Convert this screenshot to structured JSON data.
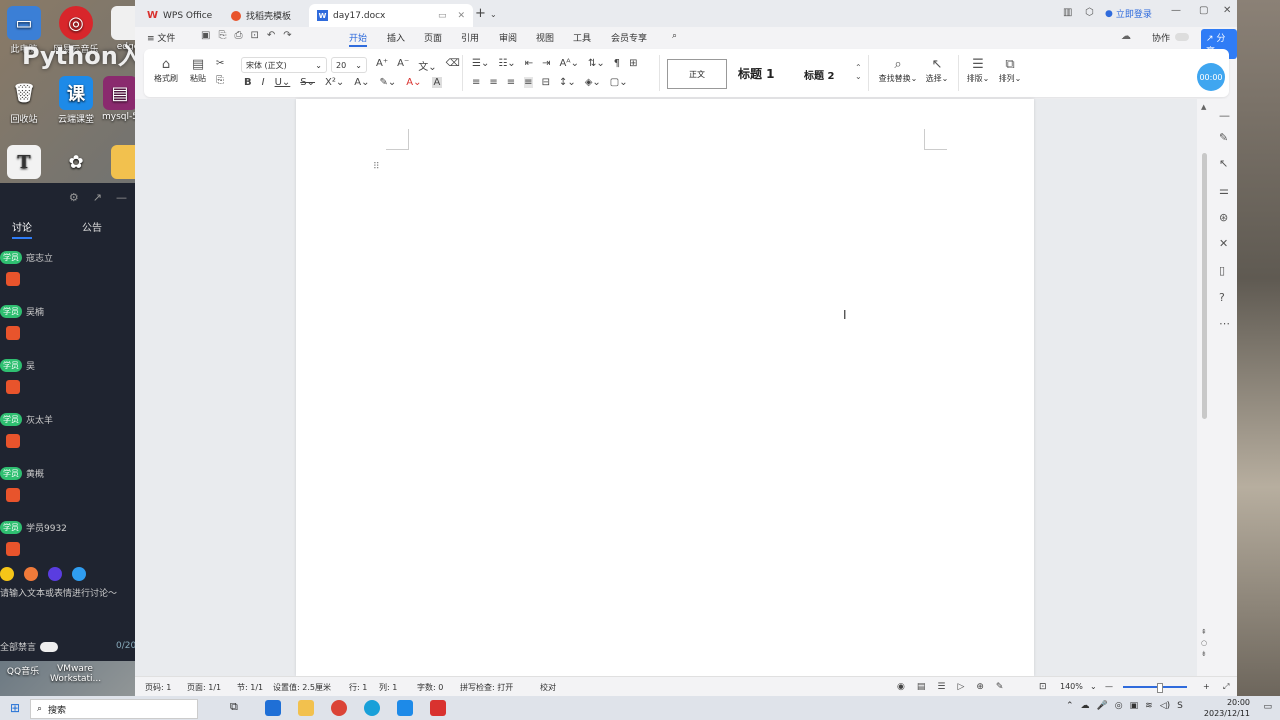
{
  "desktop": {
    "icons": [
      {
        "label": "此电脑"
      },
      {
        "label": "网易云音乐"
      },
      {
        "label": "edge"
      },
      {
        "label": "回收站"
      },
      {
        "label": "云端课堂"
      },
      {
        "label": "mysql-5"
      },
      {
        "label": ""
      },
      {
        "label": ""
      },
      {
        "label": ""
      }
    ],
    "watermark": "Python入门教程   [课后学习]",
    "bottom_icons": [
      "QQ音乐",
      "VMware Workstati..."
    ]
  },
  "chat": {
    "tabs": [
      "讨论",
      "公告"
    ],
    "badge": "学员",
    "messages": [
      {
        "name": "寇志立"
      },
      {
        "name": "吴楠"
      },
      {
        "name": "吴"
      },
      {
        "name": "灰太羊"
      },
      {
        "name": "黄概"
      },
      {
        "name": "学员9932"
      }
    ],
    "input_placeholder": "请输入文本或表情进行讨论～",
    "mute_all": "全部禁言",
    "count": "0/20"
  },
  "wps": {
    "tabs": [
      {
        "label": "WPS Office"
      },
      {
        "label": "找稻壳模板"
      },
      {
        "label": "day17.docx"
      }
    ],
    "login": "立即登录",
    "menu": [
      "文件",
      "开始",
      "插入",
      "页面",
      "引用",
      "审阅",
      "视图",
      "工具",
      "会员专享"
    ],
    "collab": "协作",
    "share": "分享",
    "ribbon": {
      "format_painter": "格式刷",
      "paste": "粘贴",
      "font": "宋体 (正文)",
      "size": "20",
      "styles": [
        "正文",
        "标题 1",
        "标题 2"
      ],
      "find_replace": "查找替换",
      "select": "选择",
      "layout": "排版",
      "arrange": "排列",
      "timer": "00:00"
    },
    "status": {
      "page_num": "页码: 1",
      "pages": "页面: 1/1",
      "section": "节: 1/1",
      "setting": "设置值: 2.5厘米",
      "row": "行: 1",
      "col": "列: 1",
      "words": "字数: 0",
      "spell": "拼写检查: 打开",
      "proof": "校对",
      "zoom": "140%"
    }
  },
  "taskbar": {
    "search": "搜索",
    "time": "20:00",
    "date": "2023/12/11"
  },
  "colors": {
    "accent": "#2f6bdc",
    "chat_bg": "#1f2430",
    "share": "#2f7cf6"
  }
}
